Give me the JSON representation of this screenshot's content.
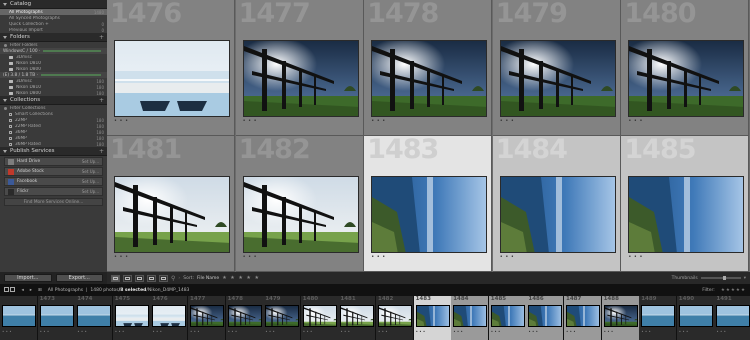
{
  "left_panel": {
    "catalog": {
      "title": "Catalog",
      "items": [
        {
          "label": "All Photographs",
          "count": "1480",
          "selected": true
        },
        {
          "label": "All Synced Photographs",
          "count": "",
          "selected": false
        },
        {
          "label": "Quick Collection +",
          "count": "0",
          "selected": false
        },
        {
          "label": "Previous Import",
          "count": "0",
          "selected": false
        }
      ]
    },
    "folders": {
      "title": "Folders",
      "filter_label": "Filter Folders",
      "volumes": [
        {
          "label": "WindowsC / 100 ·",
          "value": ""
        },
        {
          "label": "(E) 3.8 / 1.8 TB ·",
          "value": ""
        }
      ],
      "volume1_items": [
        {
          "label": "3Dmisc",
          "count": ""
        },
        {
          "label": "Nikon D810",
          "count": ""
        },
        {
          "label": "Nikon D800",
          "count": ""
        }
      ],
      "volume2_items": [
        {
          "label": "3Dmisc",
          "count": "180"
        },
        {
          "label": "Nikon D810",
          "count": "180"
        },
        {
          "label": "Nikon D800",
          "count": "180"
        }
      ]
    },
    "collections": {
      "title": "Collections",
      "filter_label": "Filter Collections",
      "items": [
        {
          "label": "Smart Collections",
          "count": ""
        },
        {
          "label": "22MP",
          "count": "180"
        },
        {
          "label": "22MP Rated",
          "count": "180"
        },
        {
          "label": "36MP",
          "count": "180"
        },
        {
          "label": "36MP",
          "count": "180"
        },
        {
          "label": "36MP Rated",
          "count": "180"
        }
      ]
    },
    "publish": {
      "title": "Publish Services",
      "services": [
        {
          "label": "Hard Drive",
          "action": "Set Up...",
          "color": "#7d7d7d"
        },
        {
          "label": "Adobe Stock",
          "action": "Set Up...",
          "color": "#c0392b"
        },
        {
          "label": "Facebook",
          "action": "Set Up...",
          "color": "#3b5998"
        },
        {
          "label": "Flickr",
          "action": "Set Up...",
          "color": "#2a2a2a"
        }
      ],
      "find_more": "Find More Services Online..."
    }
  },
  "buttons": {
    "import": "Import...",
    "export": "Export..."
  },
  "grid": {
    "cells": [
      {
        "number": "1476",
        "state": "normal",
        "scene": "pool",
        "dots": "• • •"
      },
      {
        "number": "1477",
        "state": "normal",
        "scene": "dock-dark",
        "dots": "• • •"
      },
      {
        "number": "1478",
        "state": "normal",
        "scene": "dock-dark",
        "dots": "• • •"
      },
      {
        "number": "1479",
        "state": "normal",
        "scene": "dock-dark",
        "dots": "• • •"
      },
      {
        "number": "1480",
        "state": "normal",
        "scene": "dock-dark",
        "dots": "• • •"
      },
      {
        "number": "1481",
        "state": "normal",
        "scene": "dock-bright",
        "dots": "• • •"
      },
      {
        "number": "1482",
        "state": "normal",
        "scene": "dock-bright",
        "dots": "• • •"
      },
      {
        "number": "1483",
        "state": "active",
        "scene": "coast-tilt",
        "dots": "• • •"
      },
      {
        "number": "1484",
        "state": "selected",
        "scene": "coast-tilt",
        "dots": "• • •"
      },
      {
        "number": "1485",
        "state": "selected",
        "scene": "coast-tilt",
        "dots": "• • •"
      }
    ]
  },
  "toolbar": {
    "sort_label": "Sort:",
    "sort_value": "File Name",
    "stars": "★ ★ ★ ★ ★",
    "thumbnails_label": "Thumbnails"
  },
  "film_bar": {
    "pages": "1  2",
    "source": "All Photographs",
    "summary": "1480 photos",
    "selected": "/8 selected",
    "file": "/Nikon_D4MP_1483"
  },
  "filmstrip": {
    "filter_label": "Filter:",
    "cells": [
      {
        "number": "",
        "state": "normal",
        "scene": "sea"
      },
      {
        "number": "1473",
        "state": "normal",
        "scene": "sea"
      },
      {
        "number": "1474",
        "state": "normal",
        "scene": "sea"
      },
      {
        "number": "1475",
        "state": "normal",
        "scene": "pool"
      },
      {
        "number": "1476",
        "state": "normal",
        "scene": "pool"
      },
      {
        "number": "1477",
        "state": "normal",
        "scene": "dock-dark"
      },
      {
        "number": "1478",
        "state": "normal",
        "scene": "dock-dark"
      },
      {
        "number": "1479",
        "state": "normal",
        "scene": "dock-dark"
      },
      {
        "number": "1480",
        "state": "normal",
        "scene": "dock-bright"
      },
      {
        "number": "1481",
        "state": "normal",
        "scene": "dock-bright"
      },
      {
        "number": "1482",
        "state": "normal",
        "scene": "dock-bright"
      },
      {
        "number": "1483",
        "state": "active",
        "scene": "coast-tilt"
      },
      {
        "number": "1484",
        "state": "selected",
        "scene": "coast-tilt"
      },
      {
        "number": "1485",
        "state": "selected",
        "scene": "coast-tilt"
      },
      {
        "number": "1486",
        "state": "selected",
        "scene": "coast-tilt"
      },
      {
        "number": "1487",
        "state": "selected",
        "scene": "coast-tilt"
      },
      {
        "number": "1488",
        "state": "selected",
        "scene": "dock-dark"
      },
      {
        "number": "1489",
        "state": "normal",
        "scene": "sea"
      },
      {
        "number": "1490",
        "state": "normal",
        "scene": "sea"
      },
      {
        "number": "1491",
        "state": "normal",
        "scene": "sea"
      }
    ]
  }
}
